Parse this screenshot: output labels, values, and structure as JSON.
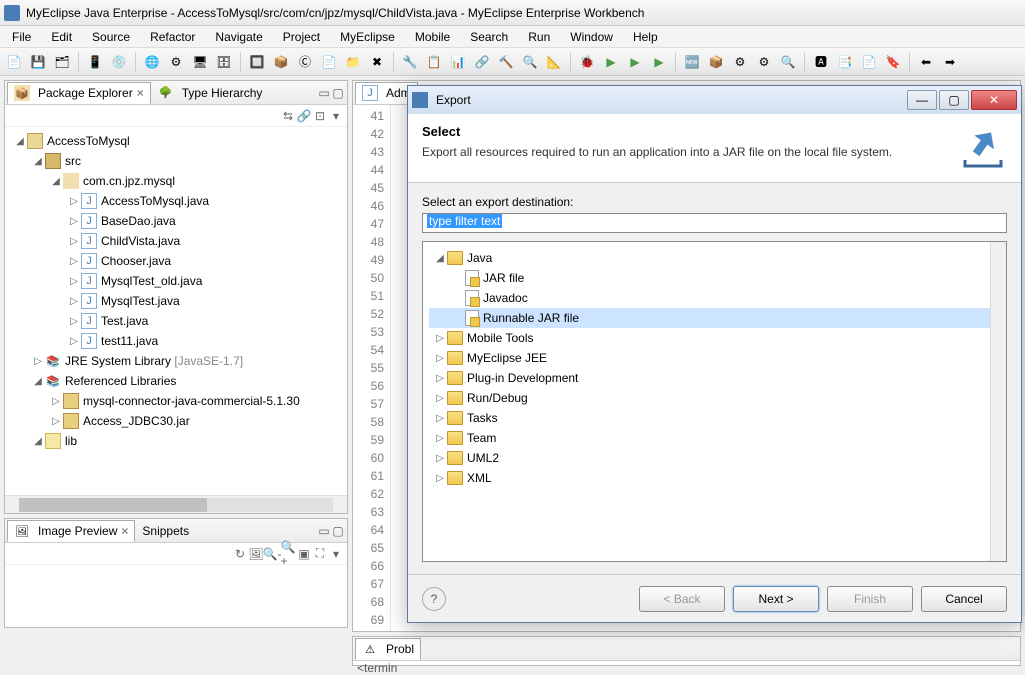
{
  "title": "MyEclipse Java Enterprise - AccessToMysql/src/com/cn/jpz/mysql/ChildVista.java - MyEclipse Enterprise Workbench",
  "menus": [
    "File",
    "Edit",
    "Source",
    "Refactor",
    "Navigate",
    "Project",
    "MyEclipse",
    "Mobile",
    "Search",
    "Run",
    "Window",
    "Help"
  ],
  "pkgExplorer": {
    "title": "Package Explorer",
    "hierTab": "Type Hierarchy"
  },
  "tree": {
    "project": "AccessToMysql",
    "src": "src",
    "pkg": "com.cn.jpz.mysql",
    "files": [
      "AccessToMysql.java",
      "BaseDao.java",
      "ChildVista.java",
      "Chooser.java",
      "MysqlTest_old.java",
      "MysqlTest.java",
      "Test.java",
      "test11.java"
    ],
    "jre": "JRE System Library",
    "jreVer": "[JavaSE-1.7]",
    "refLib": "Referenced Libraries",
    "jars": [
      "mysql-connector-java-commercial-5.1.30",
      "Access_JDBC30.jar"
    ],
    "lib": "lib"
  },
  "preview": {
    "tab": "Image Preview",
    "snippets": "Snippets"
  },
  "editorTab": "Adm",
  "lines": [
    "41",
    "42",
    "43",
    "44",
    "45",
    "46",
    "47",
    "48",
    "49",
    "50",
    "51",
    "52",
    "53",
    "54",
    "55",
    "56",
    "57",
    "58",
    "59",
    "60",
    "61",
    "62",
    "63",
    "64",
    "65",
    "66",
    "67",
    "68",
    "69"
  ],
  "problemsTab": "Probl",
  "problemsBody": "<termin",
  "dialog": {
    "title": "Export",
    "heading": "Select",
    "desc": "Export all resources required to run an application into a JAR file on the local file system.",
    "destLabel": "Select an export destination:",
    "filter": "type filter text",
    "java": "Java",
    "jarFile": "JAR file",
    "javadoc": "Javadoc",
    "runJar": "Runnable JAR file",
    "cats": [
      "Mobile Tools",
      "MyEclipse JEE",
      "Plug-in Development",
      "Run/Debug",
      "Tasks",
      "Team",
      "UML2",
      "XML"
    ],
    "back": "< Back",
    "next": "Next >",
    "finish": "Finish",
    "cancel": "Cancel"
  }
}
